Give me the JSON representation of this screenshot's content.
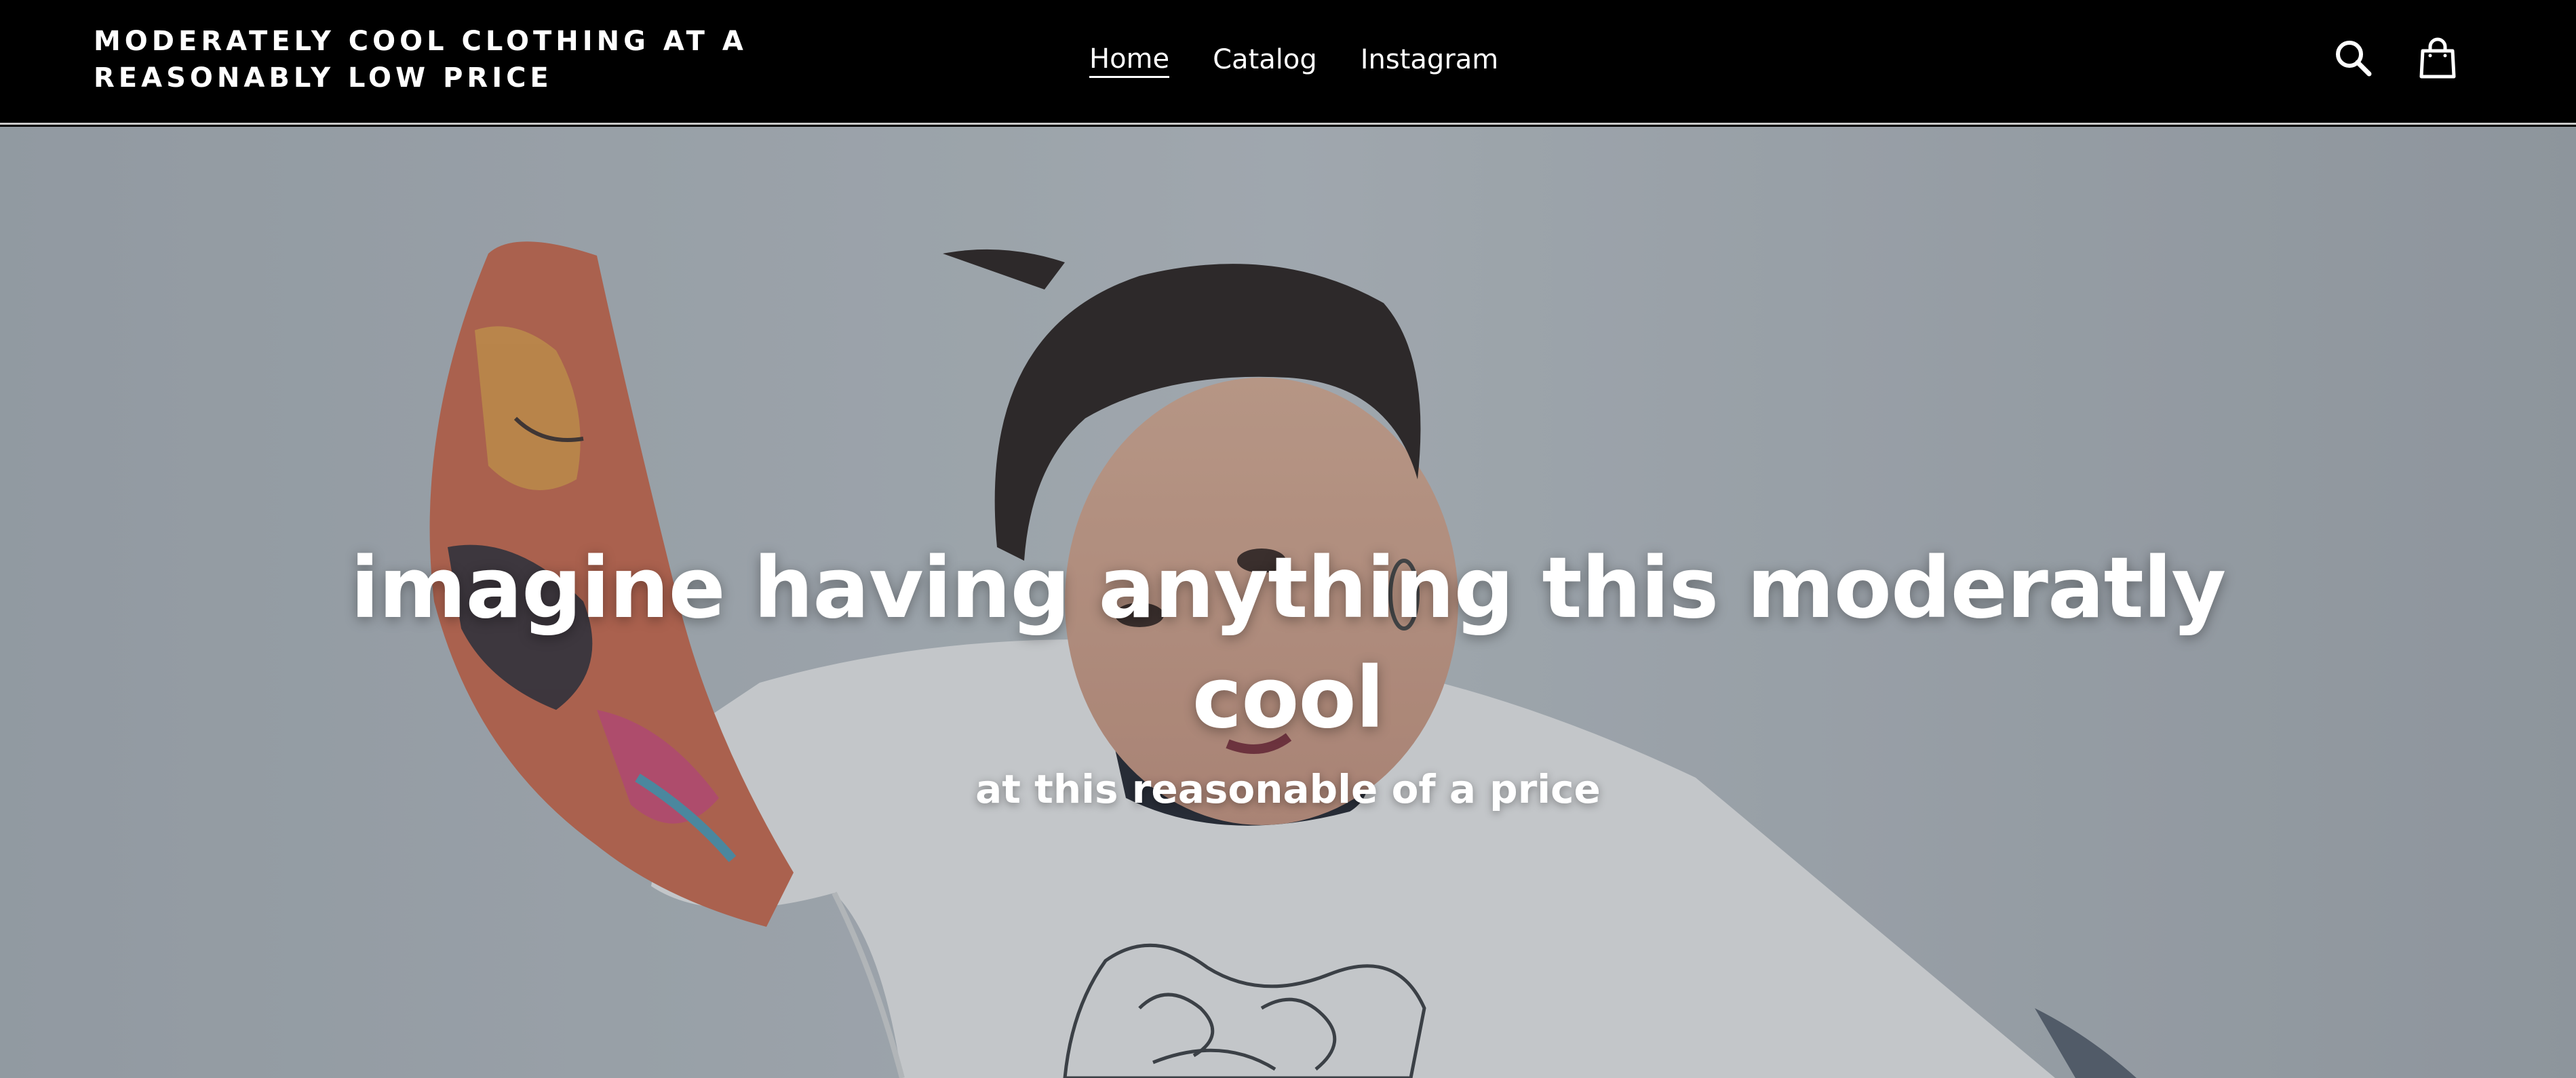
{
  "header": {
    "logo_text": "MODERATELY COOL CLOTHING AT A REASONABLY LOW PRICE",
    "nav": [
      {
        "label": "Home",
        "active": true
      },
      {
        "label": "Catalog",
        "active": false
      },
      {
        "label": "Instagram",
        "active": false
      }
    ],
    "icons": [
      "search-icon",
      "cart-icon"
    ]
  },
  "hero": {
    "title": "imagine having anything this moderatly cool",
    "subtitle": "at this reasonable of a price"
  },
  "colors": {
    "header_bg": "#000000",
    "header_text": "#ffffff",
    "hero_bg": "#a3aab1",
    "hero_text": "#ffffff"
  }
}
